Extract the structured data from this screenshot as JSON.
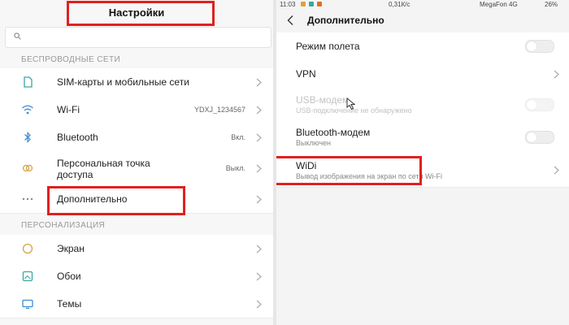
{
  "left": {
    "title": "Настройки",
    "search_placeholder": "",
    "section_wireless": "БЕСПРОВОДНЫЕ СЕТИ",
    "section_personal": "ПЕРСОНАЛИЗАЦИЯ",
    "rows": [
      {
        "label": "SIM-карты и мобильные сети",
        "value": "",
        "icon": "sim-card-icon"
      },
      {
        "label": "Wi-Fi",
        "value": "YDXJ_1234567",
        "icon": "wifi-icon"
      },
      {
        "label": "Bluetooth",
        "value": "Вкл.",
        "icon": "bluetooth-icon"
      },
      {
        "label": "Персональная точка",
        "label2": "доступа",
        "value": "Выкл.",
        "icon": "hotspot-icon"
      },
      {
        "label": "Дополнительно",
        "value": "",
        "icon": "more-icon"
      },
      {
        "label": "Экран",
        "value": "",
        "icon": "display-icon"
      },
      {
        "label": "Обои",
        "value": "",
        "icon": "wallpaper-icon"
      },
      {
        "label": "Темы",
        "value": "",
        "icon": "themes-icon"
      }
    ]
  },
  "right": {
    "status": {
      "time": "11:03",
      "speed": "0,31К/с",
      "carrier": "MegaFon 4G",
      "battery": "26%"
    },
    "title": "Дополнительно",
    "rows": [
      {
        "label": "Режим полета",
        "sub": "",
        "control": "toggle",
        "enabled": true,
        "on": false
      },
      {
        "label": "VPN",
        "sub": "",
        "control": "chevron",
        "enabled": true
      },
      {
        "label": "USB-модем",
        "sub": "USB-подключение не обнаружено",
        "control": "toggle",
        "enabled": false,
        "on": false
      },
      {
        "label": "Bluetooth-модем",
        "sub": "Выключен",
        "control": "toggle",
        "enabled": true,
        "on": false
      },
      {
        "label": "WiDi",
        "sub": "Вывод изображения на экран по сети Wi-Fi",
        "control": "chevron",
        "enabled": true
      }
    ]
  },
  "colors": {
    "annotation_red": "#e0201f",
    "icon_accent": "#d9a441",
    "icon_teal": "#3aa7a0",
    "icon_blue": "#3b8bd6"
  }
}
